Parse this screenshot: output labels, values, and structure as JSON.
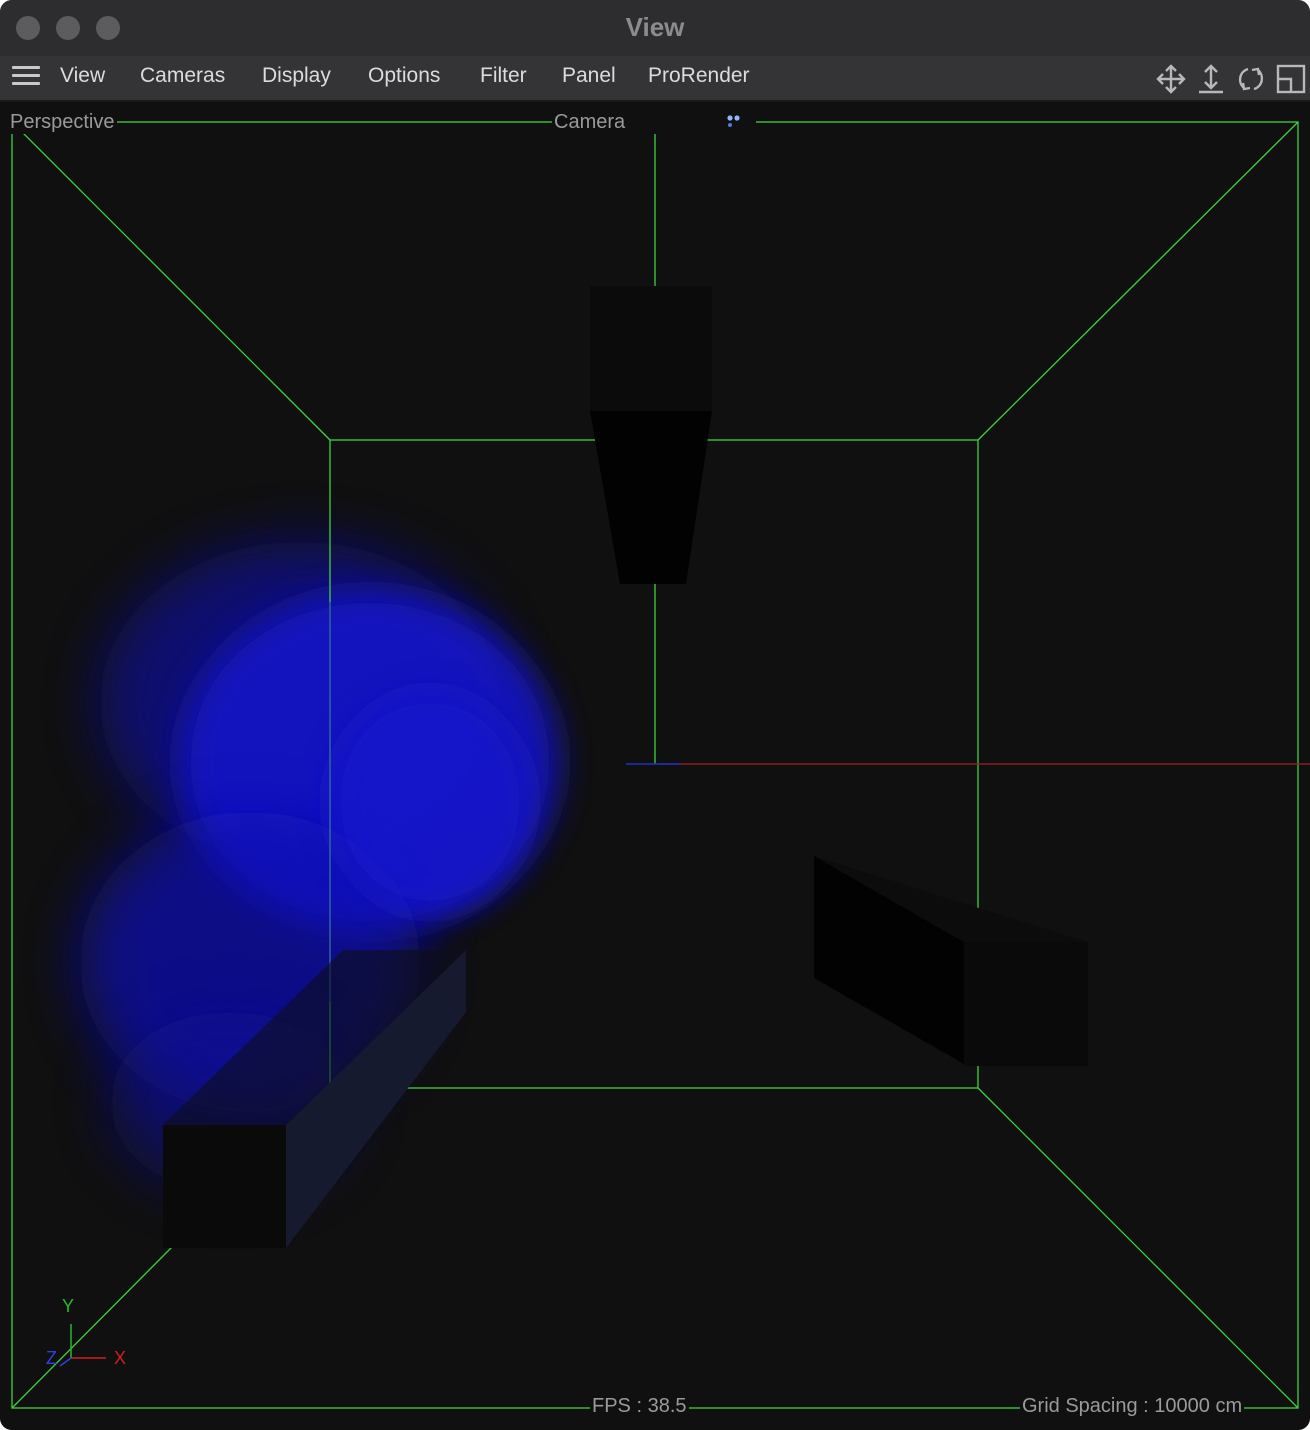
{
  "window": {
    "title": "View"
  },
  "menubar": {
    "items": [
      {
        "label": "View"
      },
      {
        "label": "Cameras"
      },
      {
        "label": "Display"
      },
      {
        "label": "Options"
      },
      {
        "label": "Filter"
      },
      {
        "label": "Panel"
      },
      {
        "label": "ProRender"
      }
    ],
    "tools": [
      "move-view-icon",
      "zoom-view-icon",
      "rotate-view-icon",
      "toggle-panel-icon"
    ]
  },
  "viewport": {
    "projection": "Perspective",
    "camera": "Camera",
    "fps": "FPS : 38.5",
    "grid_spacing": "Grid Spacing : 10000 cm",
    "axes": {
      "y": "Y",
      "z": "Z",
      "x": "X"
    },
    "colors": {
      "background": "#101010",
      "wireframe": "#3fd13f",
      "volume": "#1010c8",
      "x_axis": "#d02020",
      "y_axis": "#28b828",
      "z_axis": "#3040e0"
    }
  }
}
